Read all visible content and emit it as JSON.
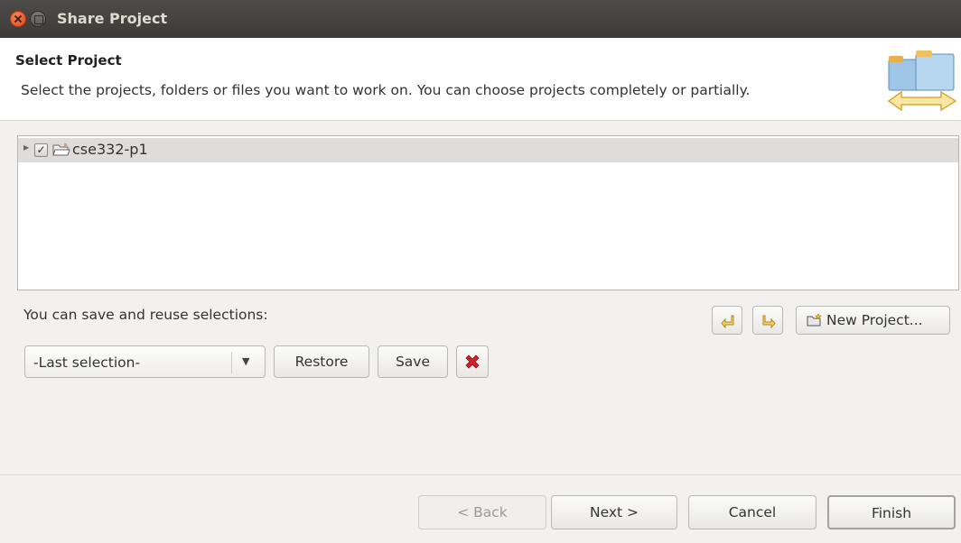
{
  "window": {
    "title": "Share Project"
  },
  "header": {
    "title": "Select Project",
    "description": "Select the projects, folders or files you want to work on. You can choose projects completely or partially."
  },
  "tree": {
    "items": [
      {
        "label": "cse332-p1",
        "checked": true,
        "expanded": false
      }
    ]
  },
  "selections": {
    "label": "You can save and reuse selections:",
    "combo_value": "-Last selection-",
    "restore_label": "Restore",
    "save_label": "Save",
    "new_project_label": "New Project..."
  },
  "footer": {
    "back_label": "< Back",
    "next_label": "Next >",
    "cancel_label": "Cancel",
    "finish_label": "Finish"
  },
  "colors": {
    "title_bar": "#3d3b37",
    "close_button": "#e0461a",
    "selected_row": "#dedddb",
    "delete_icon": "#d0202a"
  }
}
